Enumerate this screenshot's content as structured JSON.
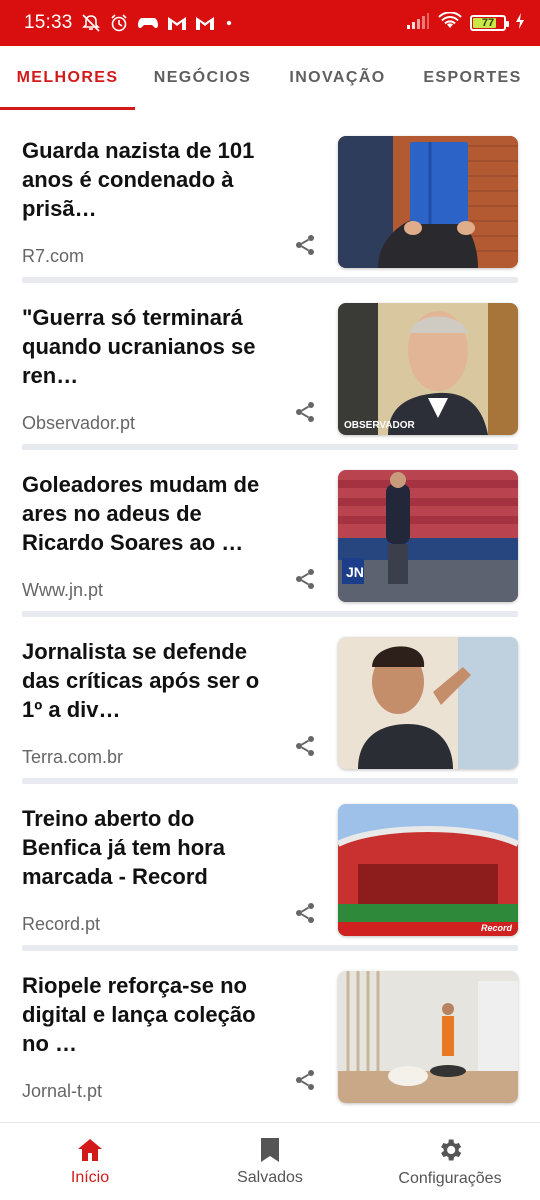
{
  "status_bar": {
    "time": "15:33",
    "battery_level": "77",
    "battery_percent": 0.77,
    "left_icons": [
      "notifications-off-icon",
      "alarm-icon",
      "game-controller-icon",
      "gmail-icon",
      "gmail-icon",
      "dot-icon"
    ],
    "right_icons": [
      "signal-icon",
      "wifi-icon",
      "battery-icon",
      "charging-icon"
    ],
    "background_color": "#d90f0f"
  },
  "tabs": [
    {
      "label": "MELHORES",
      "active": true
    },
    {
      "label": "NEGÓCIOS",
      "active": false
    },
    {
      "label": "INOVAÇÃO",
      "active": false
    },
    {
      "label": "ESPORTES",
      "active": false
    }
  ],
  "accent_color": "#d31a1a",
  "articles": [
    {
      "title": "Guarda nazista de 101 anos é condenado à prisã…",
      "source": "R7.com",
      "image": "man-hiding-face-behind-blue-folder"
    },
    {
      "title": "\"Guerra só terminará quando ucranianos se ren…",
      "source": "Observador.pt",
      "image": "man-portrait-observador",
      "image_caption": "OBSERVADOR"
    },
    {
      "title": "Goleadores mudam de ares no adeus de Ricardo Soares ao …",
      "source": "Www.jn.pt",
      "image": "coach-in-stadium-jn",
      "image_caption": "JN"
    },
    {
      "title": "Jornalista se defende das críticas após ser o 1º a div…",
      "source": "Terra.com.br",
      "image": "smiling-man-selfie"
    },
    {
      "title": "Treino aberto do Benfica já tem hora marcada - Record",
      "source": "Record.pt",
      "image": "benfica-stadium",
      "image_caption": "Record"
    },
    {
      "title": "Riopele reforça-se no digital e lança coleção no …",
      "source": "Jornal-t.pt",
      "image": "virtual-fashion-room"
    }
  ],
  "bottom_nav": [
    {
      "label": "Início",
      "icon": "home-icon",
      "active": true
    },
    {
      "label": "Salvados",
      "icon": "bookmark-icon",
      "active": false
    },
    {
      "label": "Configurações",
      "icon": "gear-icon",
      "active": false
    }
  ]
}
